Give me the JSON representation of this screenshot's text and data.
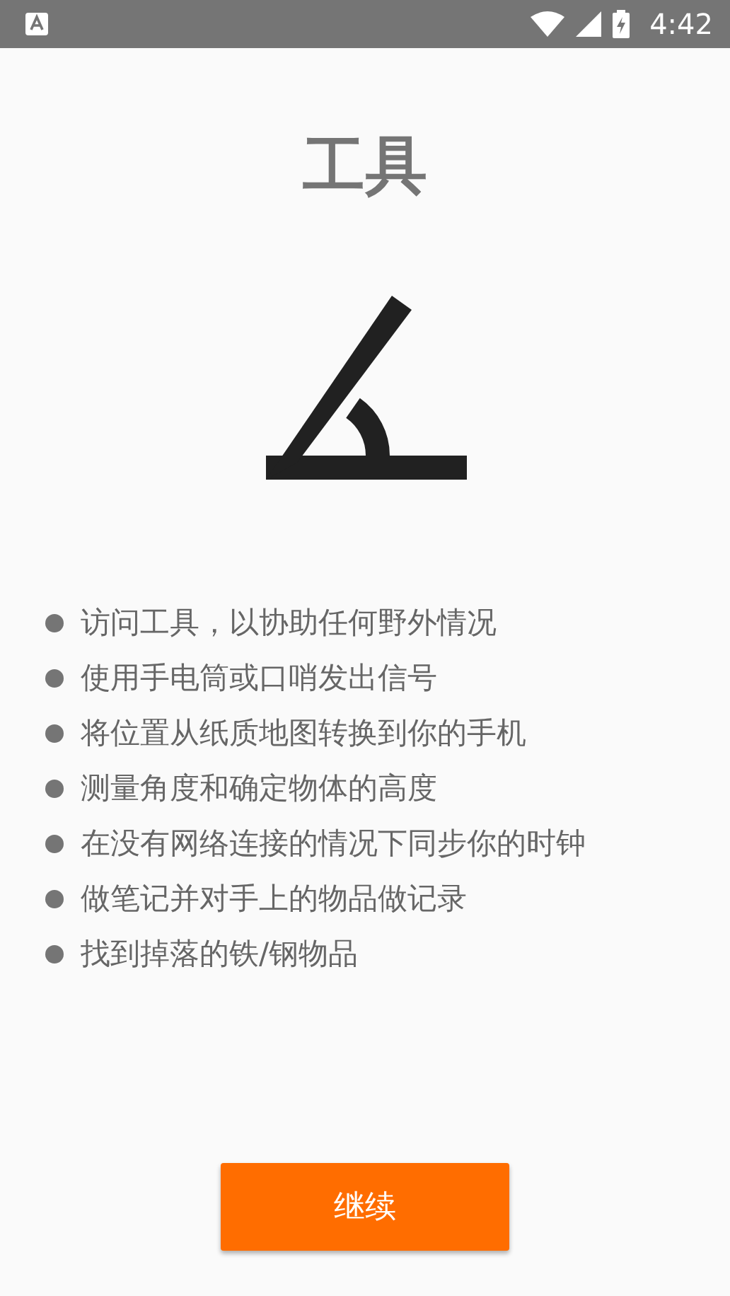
{
  "status_bar": {
    "time": "4:42"
  },
  "title": "工具",
  "features": [
    "访问工具，以协助任何野外情况",
    "使用手电筒或口哨发出信号",
    "将位置从纸质地图转换到你的手机",
    "测量角度和确定物体的高度",
    "在没有网络连接的情况下同步你的时钟",
    "做笔记并对手上的物品做记录",
    "找到掉落的铁/钢物品"
  ],
  "continue_button": "继续"
}
